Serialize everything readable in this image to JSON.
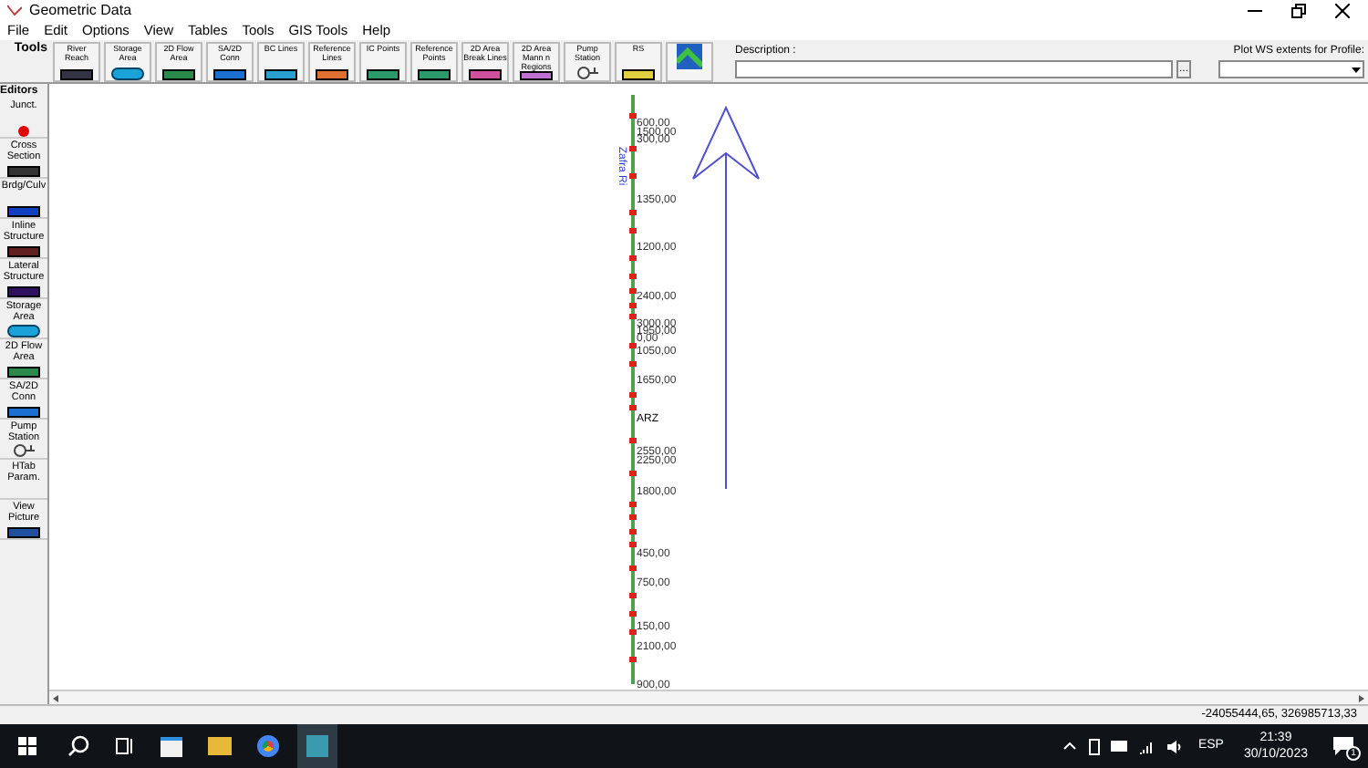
{
  "window": {
    "title": "Geometric Data"
  },
  "menu": [
    "File",
    "Edit",
    "Options",
    "View",
    "Tables",
    "Tools",
    "GIS Tools",
    "Help"
  ],
  "toolbar": {
    "tab_label": "Tools",
    "buttons": [
      {
        "label": "River Reach",
        "kind": "reach"
      },
      {
        "label": "Storage Area",
        "kind": "storage"
      },
      {
        "label": "2D Flow Area",
        "kind": "flow"
      },
      {
        "label": "SA/2D Conn",
        "kind": "conn"
      },
      {
        "label": "BC Lines",
        "kind": "bc"
      },
      {
        "label": "Reference Lines",
        "kind": "refline"
      },
      {
        "label": "IC Points",
        "kind": "icpt"
      },
      {
        "label": "Reference Points",
        "kind": "refpt"
      },
      {
        "label": "2D Area Break Lines",
        "kind": "break"
      },
      {
        "label": "2D Area Mann n Regions",
        "kind": "mann"
      },
      {
        "label": "Pump Station",
        "kind": "pump"
      },
      {
        "label": "RS",
        "kind": "rs"
      },
      {
        "kind": "gis"
      }
    ]
  },
  "description": {
    "label": "Description :",
    "button": "..."
  },
  "profile": {
    "label": "Plot WS extents for Profile:"
  },
  "editors": {
    "tab_label": "Editors",
    "items": [
      {
        "label": "Junct.",
        "kind": "junct"
      },
      {
        "label": "Cross Section",
        "kind": "xs"
      },
      {
        "label": "Brdg/Culv",
        "kind": "bridge"
      },
      {
        "label": "Inline Structure",
        "kind": "inline"
      },
      {
        "label": "Lateral Structure",
        "kind": "lateral"
      },
      {
        "label": "Storage Area",
        "kind": "storage"
      },
      {
        "label": "2D Flow Area",
        "kind": "flow"
      },
      {
        "label": "SA/2D Conn",
        "kind": "conn"
      },
      {
        "label": "Pump Station",
        "kind": "pump"
      },
      {
        "label": "HTab Param.",
        "kind": "none"
      },
      {
        "label": "View Picture",
        "kind": "camera"
      }
    ]
  },
  "river": {
    "name": "Zafra Ri",
    "junction_label": "ARZ",
    "cross_sections": [
      "600,00",
      "1500,00",
      "300,00",
      "1350,00",
      "1200,00",
      "2400,00",
      "3000,00",
      "1950,00",
      "0,00",
      "1050,00",
      "1650,00",
      "2550,00",
      "2250,00",
      "1800,00",
      "450,00",
      "750,00",
      "150,00",
      "2100,00",
      "900,00"
    ]
  },
  "status_bar": {
    "coordinates": "-24055444,65, 326985713,33"
  },
  "taskbar": {
    "language": "ESP",
    "time": "21:39",
    "date": "30/10/2023",
    "notifications": "1"
  }
}
